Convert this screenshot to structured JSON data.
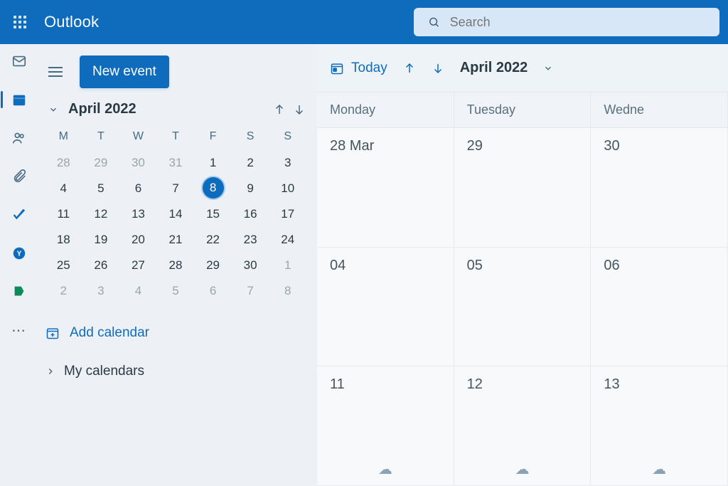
{
  "header": {
    "app_name": "Outlook",
    "search_placeholder": "Search"
  },
  "rail": {
    "items": [
      {
        "name": "mail",
        "active": false
      },
      {
        "name": "calendar",
        "active": true
      },
      {
        "name": "people",
        "active": false
      },
      {
        "name": "files",
        "active": false
      },
      {
        "name": "todo",
        "active": false
      },
      {
        "name": "yammer",
        "active": false
      },
      {
        "name": "bookings",
        "active": false
      },
      {
        "name": "more",
        "active": false
      }
    ]
  },
  "sidebar": {
    "new_event_label": "New event",
    "mini_calendar": {
      "title": "April 2022",
      "dow": [
        "M",
        "T",
        "W",
        "T",
        "F",
        "S",
        "S"
      ],
      "rows": [
        [
          {
            "n": "28",
            "muted": true
          },
          {
            "n": "29",
            "muted": true
          },
          {
            "n": "30",
            "muted": true
          },
          {
            "n": "31",
            "muted": true
          },
          {
            "n": "1"
          },
          {
            "n": "2"
          },
          {
            "n": "3"
          }
        ],
        [
          {
            "n": "4"
          },
          {
            "n": "5"
          },
          {
            "n": "6"
          },
          {
            "n": "7"
          },
          {
            "n": "8",
            "sel": true
          },
          {
            "n": "9"
          },
          {
            "n": "10"
          }
        ],
        [
          {
            "n": "11"
          },
          {
            "n": "12"
          },
          {
            "n": "13"
          },
          {
            "n": "14"
          },
          {
            "n": "15"
          },
          {
            "n": "16"
          },
          {
            "n": "17"
          }
        ],
        [
          {
            "n": "18"
          },
          {
            "n": "19"
          },
          {
            "n": "20"
          },
          {
            "n": "21"
          },
          {
            "n": "22"
          },
          {
            "n": "23"
          },
          {
            "n": "24"
          }
        ],
        [
          {
            "n": "25"
          },
          {
            "n": "26"
          },
          {
            "n": "27"
          },
          {
            "n": "28"
          },
          {
            "n": "29"
          },
          {
            "n": "30"
          },
          {
            "n": "1",
            "muted": true
          }
        ],
        [
          {
            "n": "2",
            "muted": true
          },
          {
            "n": "3",
            "muted": true
          },
          {
            "n": "4",
            "muted": true
          },
          {
            "n": "5",
            "muted": true
          },
          {
            "n": "6",
            "muted": true
          },
          {
            "n": "7",
            "muted": true
          },
          {
            "n": "8",
            "muted": true
          }
        ]
      ]
    },
    "add_calendar_label": "Add calendar",
    "my_calendars_label": "My calendars"
  },
  "toolbar": {
    "today_label": "Today",
    "month_label": "April 2022"
  },
  "grid": {
    "day_headers": [
      "Monday",
      "Tuesday",
      "Wedne"
    ],
    "rows": [
      [
        "28 Mar",
        "29",
        "30"
      ],
      [
        "04",
        "05",
        "06"
      ],
      [
        "11",
        "12",
        "13"
      ]
    ],
    "weather_row_index": 2
  },
  "colors": {
    "brand": "#0f6cbd",
    "surface": "#edf1f5",
    "muted_text": "#4a6a82"
  }
}
